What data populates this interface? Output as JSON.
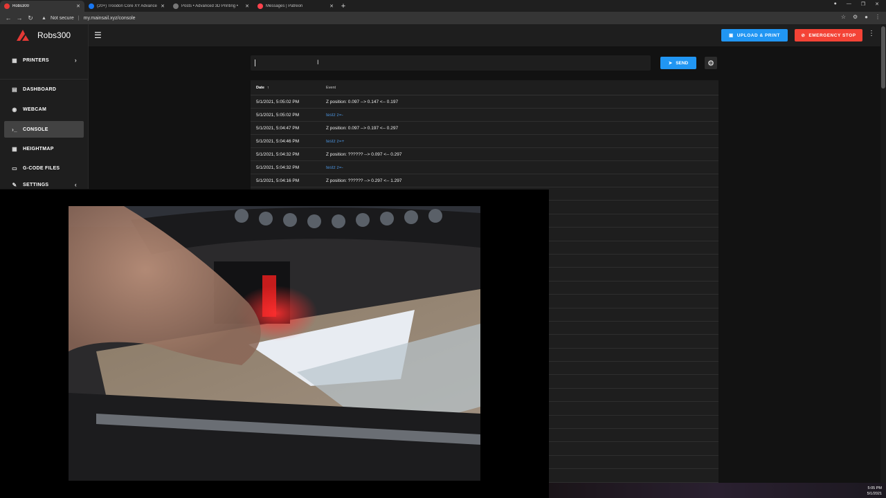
{
  "browser": {
    "tabs": [
      {
        "title": "Robs300",
        "active": true,
        "color": "#e53935"
      },
      {
        "title": "(20+) Troodon Core XY Advance",
        "active": false,
        "color": "#1877f2"
      },
      {
        "title": "Posts • Advanced 3D Printing •",
        "active": false,
        "color": "#777777"
      },
      {
        "title": "Messages | Patreon",
        "active": false,
        "color": "#ff424d"
      }
    ],
    "new_tab": "+",
    "security": "Not secure",
    "url": "my.mainsail.xyz/console"
  },
  "app": {
    "name": "Robs300",
    "upload_label": "UPLOAD & PRINT",
    "estop_label": "EMERGENCY STOP",
    "accent": "#2196f3",
    "danger": "#f44336"
  },
  "sidebar": {
    "items": [
      {
        "label": "PRINTERS",
        "icon": "printers-icon"
      },
      {
        "label": "DASHBOARD",
        "icon": "dashboard-icon"
      },
      {
        "label": "WEBCAM",
        "icon": "webcam-icon"
      },
      {
        "label": "CONSOLE",
        "icon": "console-icon",
        "active": true
      },
      {
        "label": "HEIGHTMAP",
        "icon": "heightmap-icon"
      },
      {
        "label": "G-CODE FILES",
        "icon": "gcode-files-icon"
      },
      {
        "label": "SETTINGS",
        "icon": "settings-icon"
      }
    ]
  },
  "console": {
    "input_value": "",
    "send_label": "SEND",
    "columns": {
      "date": "Date",
      "event": "Event"
    },
    "rows": [
      {
        "date": "5/1/2021, 5:05:02 PM",
        "event": "Z position: 0.097 --> 0.147 <-- 0.197",
        "type": "response"
      },
      {
        "date": "5/1/2021, 5:05:02 PM",
        "event": "testz z=-",
        "type": "command"
      },
      {
        "date": "5/1/2021, 5:04:47 PM",
        "event": "Z position: 0.097 --> 0.197 <-- 0.297",
        "type": "response"
      },
      {
        "date": "5/1/2021, 5:04:46 PM",
        "event": "testz z=+",
        "type": "command"
      },
      {
        "date": "5/1/2021, 5:04:32 PM",
        "event": "Z position: ?????? --> 0.097 <-- 0.297",
        "type": "response"
      },
      {
        "date": "5/1/2021, 5:04:32 PM",
        "event": "testz z=-",
        "type": "command"
      },
      {
        "date": "5/1/2021, 5:04:16 PM",
        "event": "Z position: ?????? --> 0.297 <-- 1.297",
        "type": "response"
      }
    ]
  },
  "taskbar": {
    "time": "5:05 PM",
    "date": "5/1/2021"
  }
}
